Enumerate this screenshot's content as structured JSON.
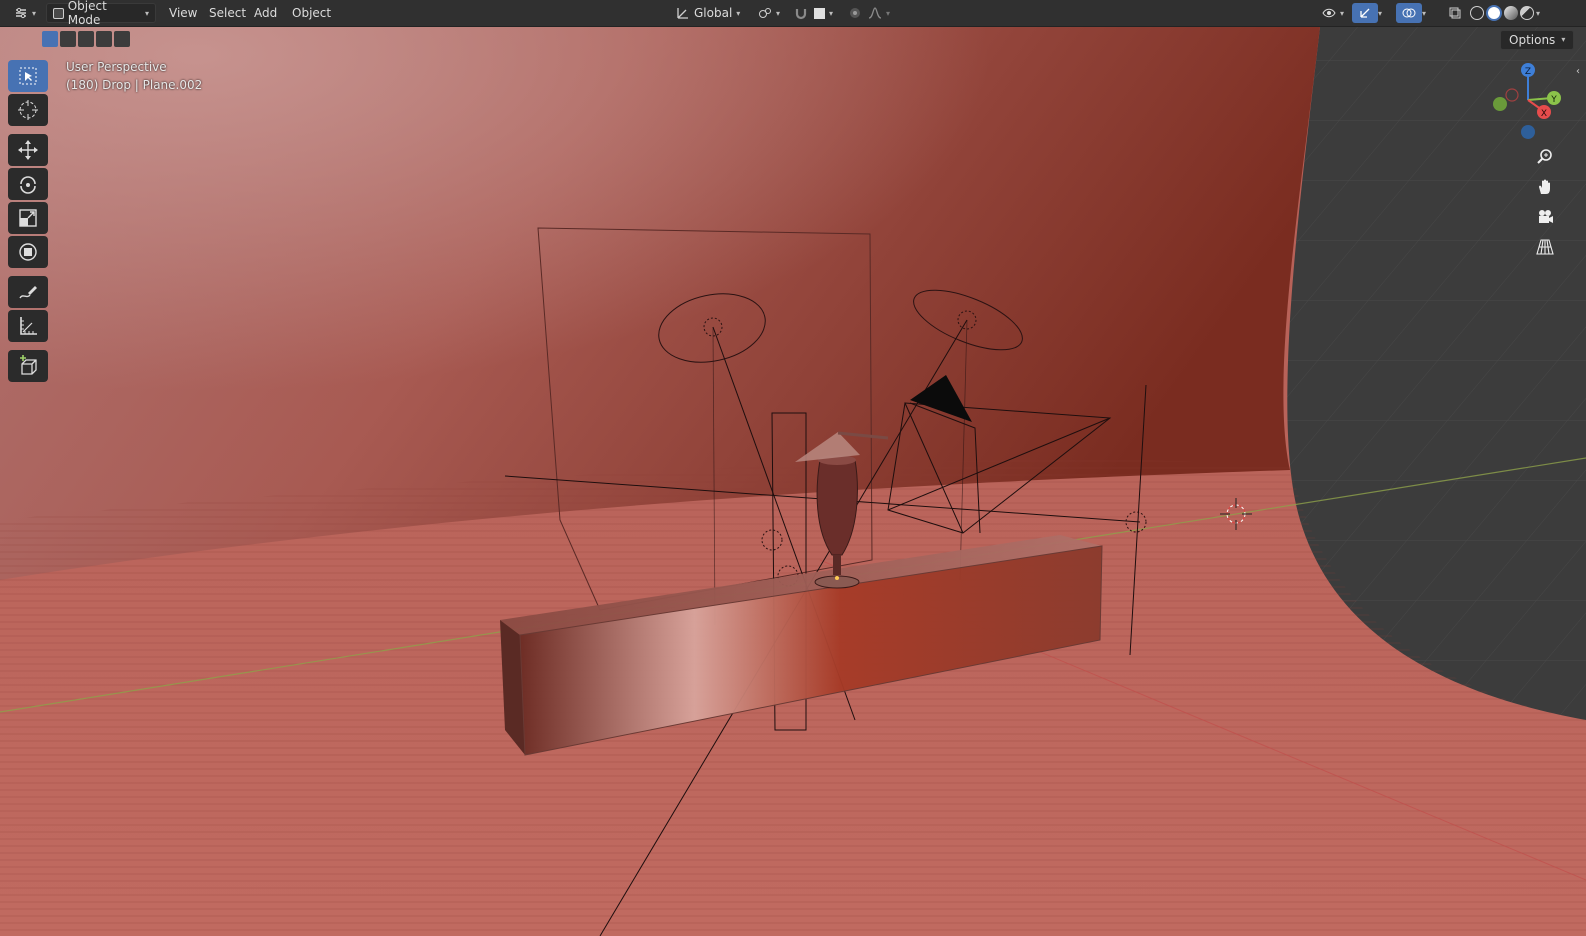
{
  "header": {
    "editor_type_icon": "editor-type-icon",
    "mode_label": "Object Mode",
    "menus": [
      "View",
      "Select",
      "Add",
      "Object"
    ],
    "transform_orientation": "Global",
    "shading_modes": [
      "wireframe",
      "solid",
      "material-preview",
      "rendered"
    ]
  },
  "viewport": {
    "view_name": "User Perspective",
    "object_info": "(180) Drop | Plane.002",
    "options_label": "Options",
    "gizmo_axes": [
      "Z",
      "Y",
      "X"
    ]
  },
  "toolbar": {
    "tools": [
      "select-box-icon",
      "cursor-icon",
      "move-icon",
      "rotate-icon",
      "scale-icon",
      "transform-icon",
      "annotate-icon",
      "measure-icon",
      "add-cube-icon"
    ]
  },
  "colors": {
    "accent": "#4772b3",
    "header_bg": "#303030",
    "backdrop": "#b85f55",
    "grid_bg": "#3d3d3d",
    "x_axis": "#e74c4c",
    "y_axis": "#8bc34a",
    "z_axis": "#3e7fd8"
  }
}
